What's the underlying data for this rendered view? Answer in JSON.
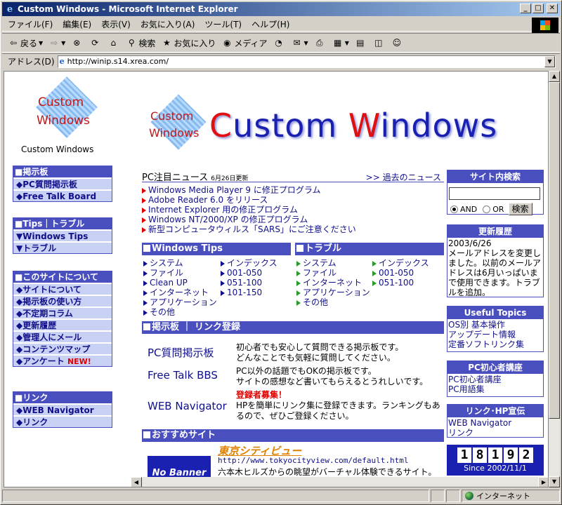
{
  "window": {
    "title": "Custom Windows - Microsoft Internet Explorer",
    "min": "_",
    "max": "□",
    "close": "✕"
  },
  "menu": [
    "ファイル(F)",
    "編集(E)",
    "表示(V)",
    "お気に入り(A)",
    "ツール(T)",
    "ヘルプ(H)"
  ],
  "toolbar": {
    "back": "戻る",
    "forward": "",
    "stop": "",
    "refresh": "",
    "home": "",
    "search": "検索",
    "favorites": "お気に入り",
    "media": "メディア"
  },
  "address": {
    "label": "アドレス(D)",
    "url": "http://winip.s14.xrea.com/"
  },
  "status": {
    "zone": "インターネット"
  },
  "logo": {
    "line1": "Custom",
    "line2": "Windows",
    "caption": "Custom Windows"
  },
  "banner": {
    "pre": "C",
    "part1": "ustom ",
    "w": "W",
    "part2": "indows"
  },
  "left_boxes": [
    {
      "title": "掲示板",
      "items": [
        "◆PC質問掲示板",
        "◆Free Talk Board"
      ]
    },
    {
      "title": "Tips｜トラブル",
      "items": [
        "▼Windows Tips",
        "▼トラブル"
      ]
    },
    {
      "title": "このサイトについて",
      "items": [
        "◆サイトについて",
        "◆掲示板の使い方",
        "◆不定期コラム",
        "◆更新履歴",
        "◆管理人にメール",
        "◆コンテンツマップ",
        "◆アンケート"
      ],
      "new_label": "NEW!"
    },
    {
      "title": "リンク",
      "items": [
        "◆WEB Navigator",
        "◆リンク"
      ]
    }
  ],
  "news": {
    "title": "PC注目ニュース",
    "date": "6月26日更新",
    "past": ">> 過去のニュース",
    "items": [
      "Windows Media Player 9 に修正プログラム",
      "Adobe Reader 6.0 をリリース",
      "Internet Explorer 用の修正プログラム",
      "Windows NT/2000/XP の修正プログラム",
      "新型コンピュータウィルス「SARS」にご注意ください"
    ]
  },
  "tips": {
    "title": "Windows Tips",
    "col1": [
      "システム",
      "ファイル",
      "Clean UP",
      "インターネット",
      "アプリケーション",
      "その他"
    ],
    "col2": [
      "インデックス",
      "001-050",
      "051-100",
      "101-150"
    ]
  },
  "trouble": {
    "title": "トラブル",
    "col1": [
      "システム",
      "ファイル",
      "インターネット",
      "アプリケーション",
      "その他"
    ],
    "col2": [
      "インデックス",
      "001-050",
      "051-100"
    ]
  },
  "bbs": {
    "title": "掲示板 ｜ リンク登録",
    "rows": [
      {
        "name": "PC質問掲示板",
        "desc1": "初心者でも安心して質問できる掲示板です。",
        "desc2": "どんなことでも気軽に質問してください。"
      },
      {
        "name": "Free Talk BBS",
        "desc1": "PC以外の話題でもOKの掲示板です。",
        "desc2": "サイトの感想など書いてもらえるとうれしいです。"
      },
      {
        "name": "WEB Navigator",
        "tag": "登録者募集！",
        "desc1": "HPを簡単にリンク集に登録できます。ランキングもあ",
        "desc2": "るので、ぜひご登録ください。"
      }
    ]
  },
  "recommend": {
    "title": "おすすめサイト",
    "banner": "No Banner",
    "site": "東京シティビュー",
    "url": "http://www.tokyocityview.com/default.html",
    "desc": "六本木ヒルズからの眺望がバーチャル体験できるサイト。"
  },
  "search": {
    "title": "サイト内検索",
    "and": "AND",
    "or": "OR",
    "button": "検索"
  },
  "history": {
    "title": "更新履歴",
    "date": "2003/6/26",
    "text": "メールアドレスを変更しました。以前のメールアドレスは6月いっぱいまで使用できます。トラブルを追加。"
  },
  "useful": {
    "title": "Useful Topics",
    "items": [
      "OS別 基本操作",
      "アップデート情報",
      "定番ソフトリンク集"
    ]
  },
  "beginner": {
    "title": "PC初心者講座",
    "items": [
      "PC初心者講座",
      "PC用語集"
    ]
  },
  "linkhp": {
    "title": "リンク･HP宣伝",
    "items": [
      "WEB Navigator",
      "リンク"
    ]
  },
  "counter": {
    "digits": [
      "1",
      "8",
      "1",
      "9",
      "2"
    ],
    "since": "Since 2002/11/1"
  }
}
